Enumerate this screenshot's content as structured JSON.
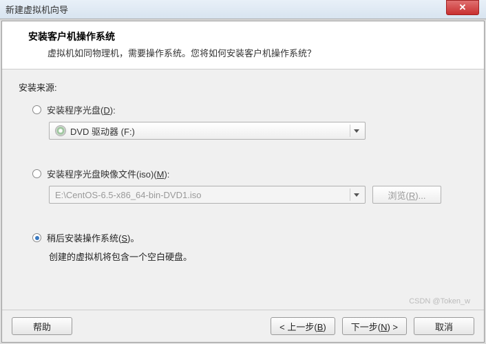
{
  "window": {
    "title": "新建虚拟机向导"
  },
  "header": {
    "title": "安装客户机操作系统",
    "desc": "虚拟机如同物理机，需要操作系统。您将如何安装客户机操作系统？"
  },
  "source": {
    "label": "安装来源:",
    "opt_disc_prefix": "安装程序光盘(",
    "opt_disc_hotkey": "D",
    "opt_disc_suffix": "):",
    "disc_value": "DVD 驱动器 (F:)",
    "opt_iso_prefix": "安装程序光盘映像文件(iso)(",
    "opt_iso_hotkey": "M",
    "opt_iso_suffix": "):",
    "iso_value": "E:\\CentOS-6.5-x86_64-bin-DVD1.iso",
    "browse_prefix": "浏览(",
    "browse_hotkey": "R",
    "browse_suffix": ")...",
    "opt_later_prefix": "稍后安装操作系统(",
    "opt_later_hotkey": "S",
    "opt_later_suffix": ")。",
    "later_note": "创建的虚拟机将包含一个空白硬盘。"
  },
  "footer": {
    "help": "帮助",
    "back_prefix": "< 上一步(",
    "back_hotkey": "B",
    "back_suffix": ")",
    "next_prefix": "下一步(",
    "next_hotkey": "N",
    "next_suffix": ") >",
    "cancel": "取消"
  },
  "watermark": "CSDN @Token_w"
}
